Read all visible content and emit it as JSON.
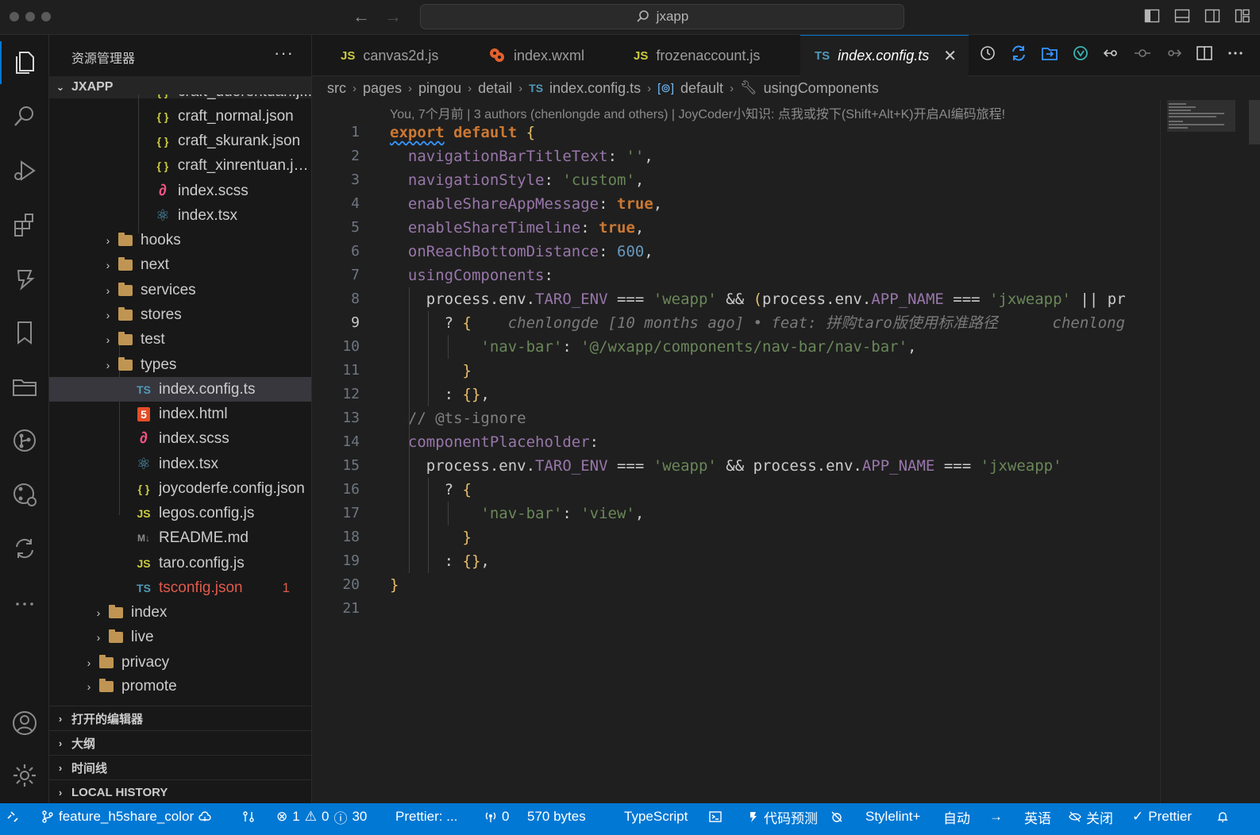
{
  "titlebar": {
    "search_text": "jxapp"
  },
  "sidebar": {
    "title": "资源管理器",
    "more": "···",
    "root": "JXAPP",
    "rows": [
      {
        "name": "craft_duorentuan.j...",
        "icon": "json"
      },
      {
        "name": "craft_normal.json",
        "icon": "json"
      },
      {
        "name": "craft_skurank.json",
        "icon": "json"
      },
      {
        "name": "craft_xinrentuan.js...",
        "icon": "json"
      },
      {
        "name": "index.scss",
        "icon": "sass"
      },
      {
        "name": "index.tsx",
        "icon": "react"
      },
      {
        "name": "hooks",
        "icon": "folder"
      },
      {
        "name": "next",
        "icon": "folder"
      },
      {
        "name": "services",
        "icon": "folder"
      },
      {
        "name": "stores",
        "icon": "folder"
      },
      {
        "name": "test",
        "icon": "folder"
      },
      {
        "name": "types",
        "icon": "folder"
      },
      {
        "name": "index.config.ts",
        "icon": "ts"
      },
      {
        "name": "index.html",
        "icon": "html"
      },
      {
        "name": "index.scss",
        "icon": "sass"
      },
      {
        "name": "index.tsx",
        "icon": "react"
      },
      {
        "name": "joycoderfe.config.json",
        "icon": "json"
      },
      {
        "name": "legos.config.js",
        "icon": "js"
      },
      {
        "name": "README.md",
        "icon": "md"
      },
      {
        "name": "taro.config.js",
        "icon": "js"
      },
      {
        "name": "tsconfig.json",
        "icon": "tsconfig",
        "badge": "1"
      },
      {
        "name": "index",
        "icon": "folder"
      },
      {
        "name": "live",
        "icon": "folder"
      },
      {
        "name": "privacy",
        "icon": "folder"
      },
      {
        "name": "promote",
        "icon": "folder"
      }
    ],
    "sections": [
      "打开的编辑器",
      "大纲",
      "时间线",
      "LOCAL HISTORY"
    ]
  },
  "tabs": [
    {
      "label": "canvas2d.js",
      "icon": "js"
    },
    {
      "label": "index.wxml",
      "icon": "wxml"
    },
    {
      "label": "frozenaccount.js",
      "icon": "js"
    },
    {
      "label": "index.config.ts",
      "icon": "ts",
      "active": true
    }
  ],
  "breadcrumb": [
    "src",
    "pages",
    "pingou",
    "detail",
    "index.config.ts",
    "default",
    "usingComponents"
  ],
  "editor": {
    "blame_header": "You, 7个月前 | 3 authors (chenlongde and others) | JoyCoder小知识: 点我或按下(Shift+Alt+K)开启AI编码旅程!",
    "current_line": 9,
    "inline_blame": "chenlongde [10 months ago] • feat: 拼购taro版使用标准路径",
    "inline_blame_tail": "chenlong",
    "line_numbers": [
      "1",
      "2",
      "3",
      "4",
      "5",
      "6",
      "7",
      "8",
      "9",
      "10",
      "11",
      "12",
      "13",
      "14",
      "15",
      "16",
      "17",
      "18",
      "19",
      "20",
      "21"
    ]
  },
  "status": {
    "branch": "feature_h5share_color",
    "errors": "1",
    "warnings": "0",
    "infos": "30",
    "prettier_status": "Prettier: ...",
    "ports": "0",
    "size": "570 bytes",
    "language": "TypeScript",
    "predict": "代码预测",
    "stylelint": "Stylelint+",
    "auto": "自动",
    "lang_en": "英语",
    "close": "关闭",
    "prettier": "Prettier"
  },
  "colors": {
    "accent": "#0078d4",
    "error": "#e05a4d"
  }
}
